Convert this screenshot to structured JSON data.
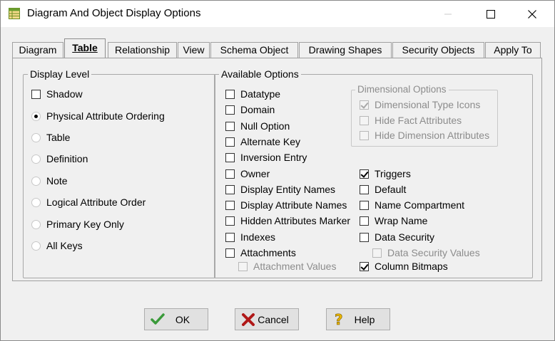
{
  "window": {
    "title": "Diagram And Object Display Options"
  },
  "tabs": [
    {
      "label": "Diagram",
      "selected": false
    },
    {
      "label": "Table",
      "selected": true
    },
    {
      "label": "Relationship",
      "selected": false
    },
    {
      "label": "View",
      "selected": false
    },
    {
      "label": "Schema Object",
      "selected": false
    },
    {
      "label": "Drawing Shapes",
      "selected": false
    },
    {
      "label": "Security Objects",
      "selected": false
    },
    {
      "label": "Apply To",
      "selected": false
    }
  ],
  "display_level": {
    "title": "Display Level",
    "shadow": {
      "label": "Shadow",
      "checked": false
    },
    "radios": [
      {
        "label": "Physical Attribute Ordering",
        "selected": true
      },
      {
        "label": "Table",
        "selected": false
      },
      {
        "label": "Definition",
        "selected": false
      },
      {
        "label": "Note",
        "selected": false
      },
      {
        "label": "Logical Attribute Order",
        "selected": false
      },
      {
        "label": "Primary Key Only",
        "selected": false
      },
      {
        "label": "All Keys",
        "selected": false
      }
    ]
  },
  "available_options": {
    "title": "Available Options",
    "left": [
      {
        "label": "Datatype",
        "checked": false
      },
      {
        "label": "Domain",
        "checked": false
      },
      {
        "label": "Null Option",
        "checked": false
      },
      {
        "label": "Alternate Key",
        "checked": false
      },
      {
        "label": "Inversion Entry",
        "checked": false
      },
      {
        "label": "Owner",
        "checked": false
      },
      {
        "label": "Display Entity Names",
        "checked": false
      },
      {
        "label": "Display Attribute Names",
        "checked": false
      },
      {
        "label": "Hidden Attributes Marker",
        "checked": false
      },
      {
        "label": "Indexes",
        "checked": false
      },
      {
        "label": "Attachments",
        "checked": false
      }
    ],
    "attachment_values": {
      "label": "Attachment Values",
      "checked": false,
      "disabled": true
    },
    "dimensional": {
      "title": "Dimensional Options",
      "items": [
        {
          "label": "Dimensional Type Icons",
          "checked": true,
          "disabled": true
        },
        {
          "label": "Hide Fact Attributes",
          "checked": false,
          "disabled": true
        },
        {
          "label": "Hide Dimension Attributes",
          "checked": false,
          "disabled": true
        }
      ]
    },
    "right": [
      {
        "label": "Triggers",
        "checked": true
      },
      {
        "label": "Default",
        "checked": false
      },
      {
        "label": "Name Compartment",
        "checked": false
      },
      {
        "label": "Wrap Name",
        "checked": false
      },
      {
        "label": "Data Security",
        "checked": false
      }
    ],
    "data_security_values": {
      "label": "Data Security Values",
      "checked": false,
      "disabled": true
    },
    "column_bitmaps": {
      "label": "Column Bitmaps",
      "checked": true
    }
  },
  "buttons": {
    "ok": "OK",
    "cancel": "Cancel",
    "help": "Help"
  },
  "colors": {
    "ok_icon": "#3a9a3a",
    "cancel_icon": "#b01818",
    "help_icon": "#e8b400"
  }
}
